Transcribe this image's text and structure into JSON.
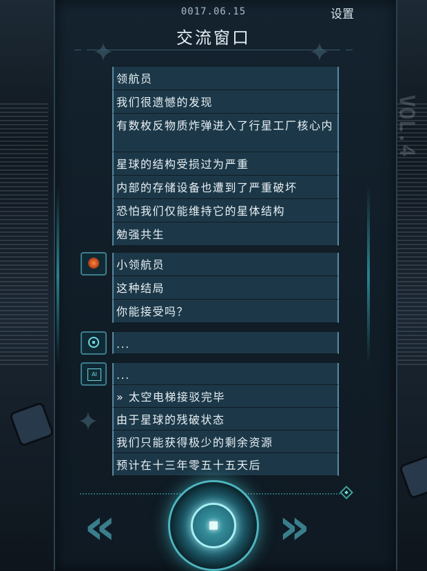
{
  "header": {
    "date": "0017.06.15",
    "settings_label": "设置",
    "title": "交流窗口"
  },
  "background": {
    "vol_text": "VOL.4"
  },
  "conversation": [
    {
      "speaker": "none",
      "messages": [
        "领航员",
        "我们很遗憾的发现",
        "有数枚反物质炸弹进入了行星工厂核心内",
        "星球的结构受损过为严重",
        "内部的存储设备也遭到了严重破坏",
        "恐怕我们仅能维持它的星体结构",
        "勉强共生"
      ]
    },
    {
      "speaker": "red-robot-avatar",
      "messages": [
        "小领航员",
        "这种结局",
        "你能接受吗？"
      ]
    },
    {
      "speaker": "eye-avatar",
      "messages": [
        "..."
      ]
    },
    {
      "speaker": "ai-chip-avatar",
      "messages": [
        "...",
        "» 太空电梯接驳完毕",
        "由于星球的残破状态",
        "我们只能获得极少的剩余资源",
        "预计在十三年零五十五天后"
      ]
    }
  ],
  "controls": {
    "prev_icon": "double-chevron-left-icon",
    "next_icon": "double-chevron-right-icon",
    "main_icon": "circular-core-button-icon",
    "marker_icon": "diamond-marker-icon",
    "prev_glyph": "«",
    "next_glyph": "»"
  },
  "colors": {
    "accent": "#4fb5c0",
    "bubble": "#1c3848",
    "panel": "#14232f"
  }
}
